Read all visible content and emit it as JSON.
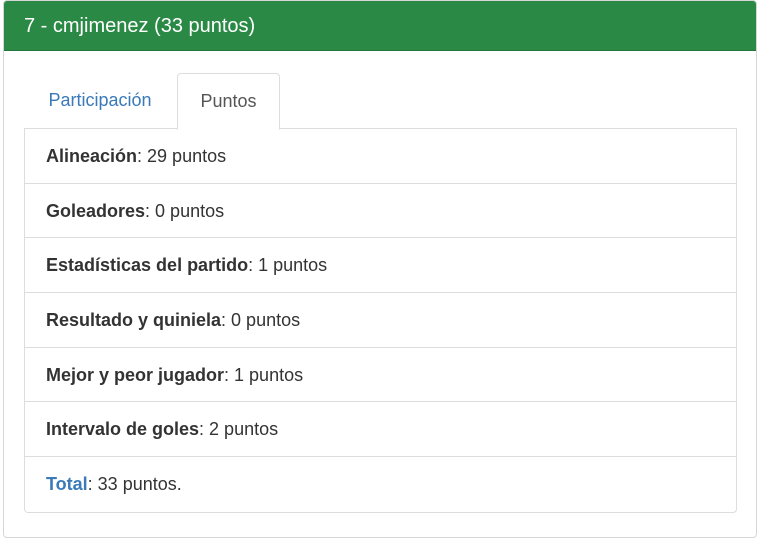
{
  "panel": {
    "title": "7 - cmjimenez (33 puntos)"
  },
  "tabs": [
    {
      "label": "Participación",
      "active": false
    },
    {
      "label": "Puntos",
      "active": true
    }
  ],
  "points": [
    {
      "label": "Alineación",
      "value": ": 29 puntos"
    },
    {
      "label": "Goleadores",
      "value": ": 0 puntos"
    },
    {
      "label": "Estadísticas del partido",
      "value": ": 1 puntos"
    },
    {
      "label": "Resultado y quiniela",
      "value": ": 0 puntos"
    },
    {
      "label": "Mejor y peor jugador",
      "value": ": 1 puntos"
    },
    {
      "label": "Intervalo de goles",
      "value": ": 2 puntos"
    }
  ],
  "total": {
    "label": "Total",
    "value": ": 33 puntos."
  },
  "colors": {
    "header_bg": "#2a8a45",
    "link": "#3a7ab8"
  }
}
